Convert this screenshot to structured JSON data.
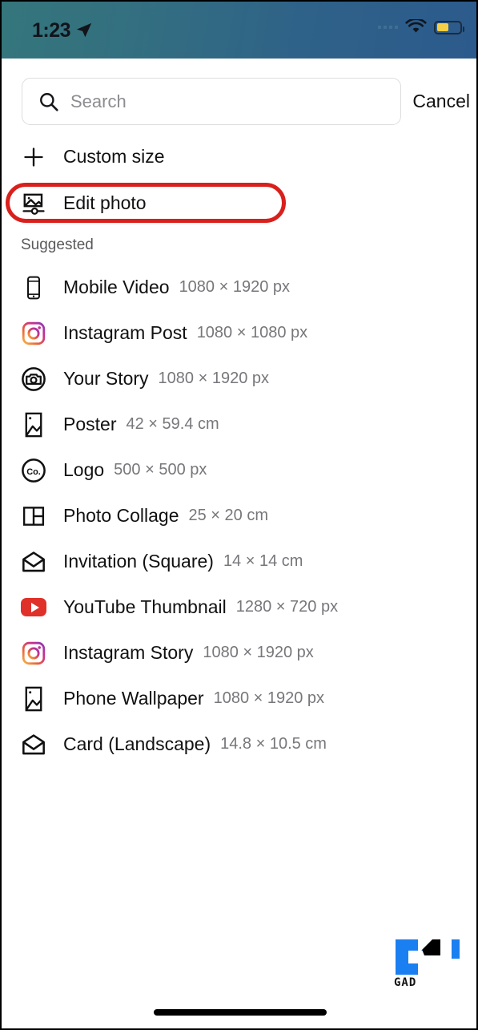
{
  "status_bar": {
    "time": "1:23",
    "location_icon": "location-arrow-icon",
    "signal_icon": "signal-dots-icon",
    "wifi_icon": "wifi-icon",
    "battery_icon": "battery-low-power-icon",
    "gradient_left": "#35767c",
    "gradient_right": "#2b5a8d",
    "battery_fill_color": "#f5cf45"
  },
  "search": {
    "placeholder": "Search",
    "value": "",
    "icon": "search-icon",
    "cancel_label": "Cancel"
  },
  "actions": [
    {
      "label": "Custom size",
      "icon": "plus-icon",
      "highlighted": false
    },
    {
      "label": "Edit photo",
      "icon": "edit-photo-icon",
      "highlighted": true
    }
  ],
  "highlight": {
    "color": "#d9201c",
    "target": "Edit photo"
  },
  "suggested": {
    "header": "Suggested",
    "items": [
      {
        "name": "Mobile Video",
        "dimensions": "1080 × 1920 px",
        "icon": "mobile-phone-icon"
      },
      {
        "name": "Instagram Post",
        "dimensions": "1080 × 1080 px",
        "icon": "instagram-icon"
      },
      {
        "name": "Your Story",
        "dimensions": "1080 × 1920 px",
        "icon": "camera-circle-icon"
      },
      {
        "name": "Poster",
        "dimensions": "42 × 59.4 cm",
        "icon": "poster-image-icon"
      },
      {
        "name": "Logo",
        "dimensions": "500 × 500 px",
        "icon": "logo-circle-icon"
      },
      {
        "name": "Photo Collage",
        "dimensions": "25 × 20 cm",
        "icon": "collage-grid-icon"
      },
      {
        "name": "Invitation (Square)",
        "dimensions": "14 × 14 cm",
        "icon": "envelope-open-icon"
      },
      {
        "name": "YouTube Thumbnail",
        "dimensions": "1280 × 720 px",
        "icon": "youtube-icon"
      },
      {
        "name": "Instagram Story",
        "dimensions": "1080 × 1920 px",
        "icon": "instagram-icon"
      },
      {
        "name": "Phone Wallpaper",
        "dimensions": "1080 × 1920 px",
        "icon": "wallpaper-image-icon"
      },
      {
        "name": "Card (Landscape)",
        "dimensions": "14.8 × 10.5 cm",
        "icon": "envelope-open-icon"
      }
    ]
  },
  "watermark": {
    "text": "GAD",
    "primary_color": "#1a7ff0",
    "secondary_color": "#000000"
  },
  "logo_icon_text": "Co."
}
